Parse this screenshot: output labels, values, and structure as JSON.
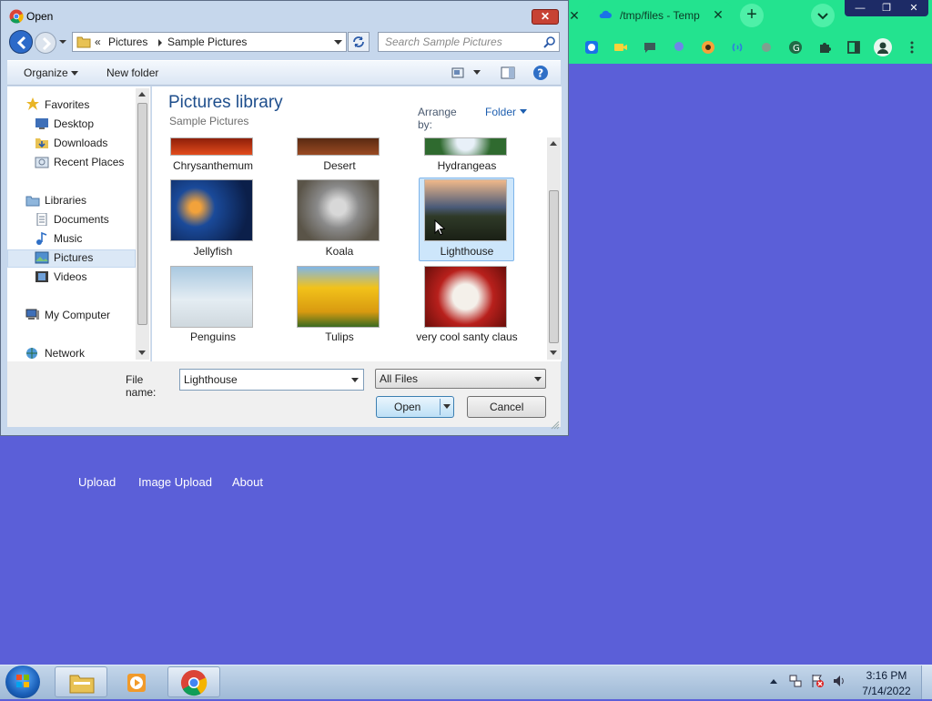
{
  "browser": {
    "tab_title": "/tmp/files - Temp",
    "close_glyph": "✕",
    "new_tab_glyph": "+",
    "window_controls": {
      "minimize": "—",
      "restore": "❐",
      "close": "✕"
    }
  },
  "webpage": {
    "nav": [
      "Upload",
      "Image Upload",
      "About"
    ]
  },
  "dialog": {
    "title": "Open",
    "breadcrumb": {
      "chevron": "«",
      "parts": [
        "Pictures",
        "Sample Pictures"
      ]
    },
    "search_placeholder": "Search Sample Pictures",
    "toolbar": {
      "organize": "Organize",
      "new_folder": "New folder"
    },
    "nav_pane": {
      "favorites_header": "Favorites",
      "favorites": [
        "Desktop",
        "Downloads",
        "Recent Places"
      ],
      "libraries_header": "Libraries",
      "libraries": [
        "Documents",
        "Music",
        "Pictures",
        "Videos"
      ],
      "computer": "My Computer",
      "network": "Network",
      "selected": "Pictures"
    },
    "library_title": "Pictures library",
    "library_subtitle": "Sample Pictures",
    "arrange_label": "Arrange by:",
    "arrange_value": "Folder",
    "files": [
      {
        "name": "Chrysanthemum"
      },
      {
        "name": "Desert"
      },
      {
        "name": "Hydrangeas"
      },
      {
        "name": "Jellyfish"
      },
      {
        "name": "Koala"
      },
      {
        "name": "Lighthouse"
      },
      {
        "name": "Penguins"
      },
      {
        "name": "Tulips"
      },
      {
        "name": "very cool santy claus"
      }
    ],
    "selected_file": "Lighthouse",
    "file_name_label": "File name:",
    "file_name_value": "Lighthouse",
    "file_type_value": "All Files",
    "open_label": "Open",
    "cancel_label": "Cancel"
  },
  "taskbar": {
    "time": "3:16 PM",
    "date": "7/14/2022"
  }
}
